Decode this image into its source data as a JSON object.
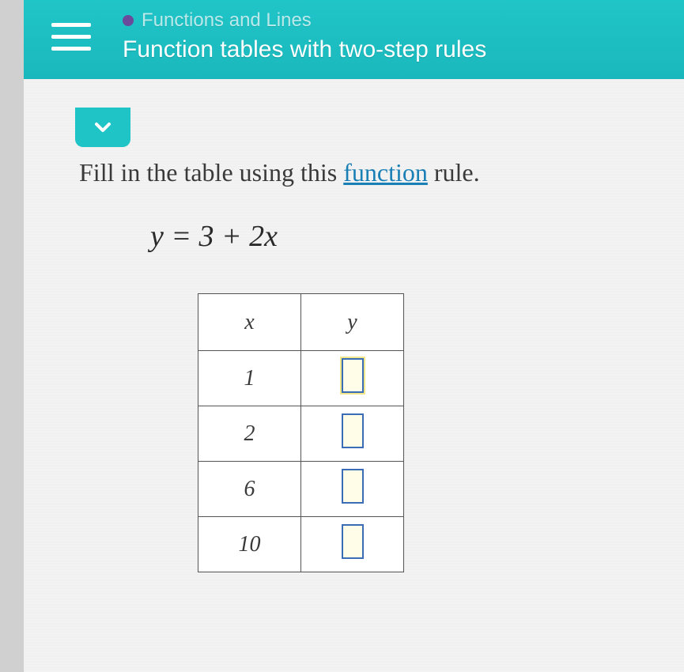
{
  "header": {
    "breadcrumb": "Functions and Lines",
    "title": "Function tables with two-step rules"
  },
  "instruction": {
    "prefix": "Fill in the table using this ",
    "link": "function",
    "suffix": " rule."
  },
  "equation": "y = 3 + 2x",
  "table": {
    "headers": {
      "col1": "x",
      "col2": "y"
    },
    "rows": [
      {
        "x": "1",
        "y": ""
      },
      {
        "x": "2",
        "y": ""
      },
      {
        "x": "6",
        "y": ""
      },
      {
        "x": "10",
        "y": ""
      }
    ]
  }
}
